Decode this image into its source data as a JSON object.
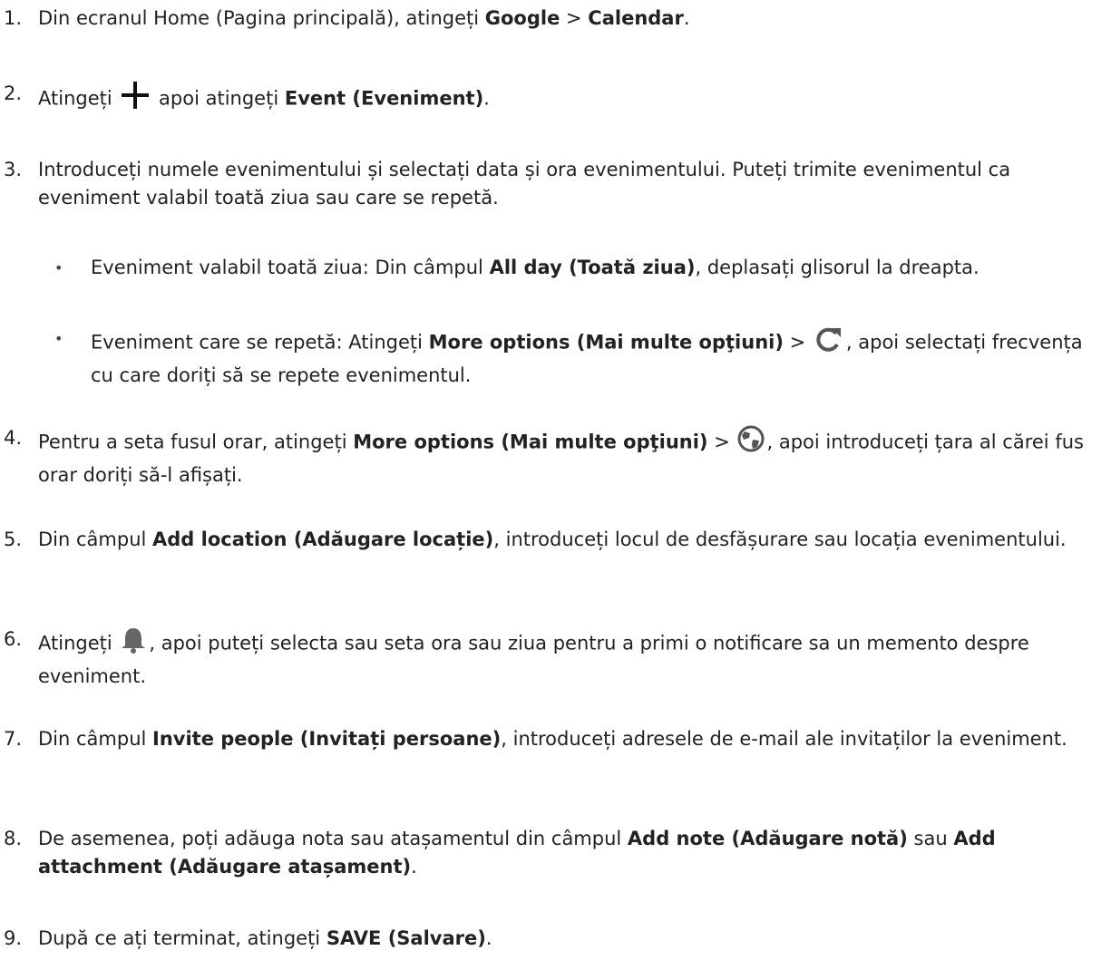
{
  "steps": {
    "s1": {
      "num": "1.",
      "a": "Din ecranul Home (Pagina principală), atingeți ",
      "b1": "Google",
      "c": " > ",
      "b2": "Calendar",
      "d": "."
    },
    "s2": {
      "num": "2.",
      "a": "Atingeți ",
      "c": " apoi atingeți ",
      "b1": "Event (Eveniment)",
      "d": "."
    },
    "s3": {
      "num": "3.",
      "a": "Introduceți numele evenimentului și selectați data și ora evenimentului. Puteți trimite evenimentul ca eveniment valabil toată ziua sau care se repetă."
    },
    "s3a": {
      "bullet": "•",
      "a": "Eveniment valabil toată ziua: Din câmpul ",
      "b1": "All day (Toată ziua)",
      "c": ", deplasați glisorul la dreapta."
    },
    "s3b": {
      "bullet": "•",
      "a": "Eveniment care se repetă: Atingeți ",
      "b1": "More options (Mai multe opţiuni)",
      "c": " > ",
      "d": ", apoi selectați frecvența cu care doriți să se repete evenimentul."
    },
    "s4": {
      "num": "4.",
      "a": "Pentru a seta fusul orar, atingeți ",
      "b1": "More options (Mai multe opţiuni)",
      "c": " > ",
      "d": ", apoi introduceți țara al cărei fus orar doriți să-l afișați."
    },
    "s5": {
      "num": "5.",
      "a": "Din câmpul ",
      "b1": "Add location (Adăugare locație)",
      "c": ", introduceți locul de desfășurare sau locația evenimentului."
    },
    "s6": {
      "num": "6.",
      "a": "Atingeți ",
      "c": ", apoi puteți selecta sau seta ora sau ziua pentru a primi o notificare sa un memento despre eveniment."
    },
    "s7": {
      "num": "7.",
      "a": "Din câmpul ",
      "b1": "Invite people (Invitați persoane)",
      "c": ", introduceți adresele de e-mail ale invitaților la eveniment."
    },
    "s8": {
      "num": "8.",
      "a": "De asemenea, poți adăuga nota sau atașamentul din câmpul ",
      "b1": "Add note (Adăugare notă)",
      "c": " sau ",
      "b2": "Add attachment (Adăugare atașament)",
      "d": "."
    },
    "s9": {
      "num": "9.",
      "a": "După ce ați terminat, atingeți ",
      "b1": "SAVE (Salvare)",
      "d": "."
    }
  },
  "icons": {
    "plus": "plus-icon",
    "repeat": "repeat-icon",
    "globe": "globe-icon",
    "bell": "bell-icon"
  },
  "colors": {
    "text": "#222222",
    "icon": "#555555",
    "icon_bold": "#111111"
  }
}
